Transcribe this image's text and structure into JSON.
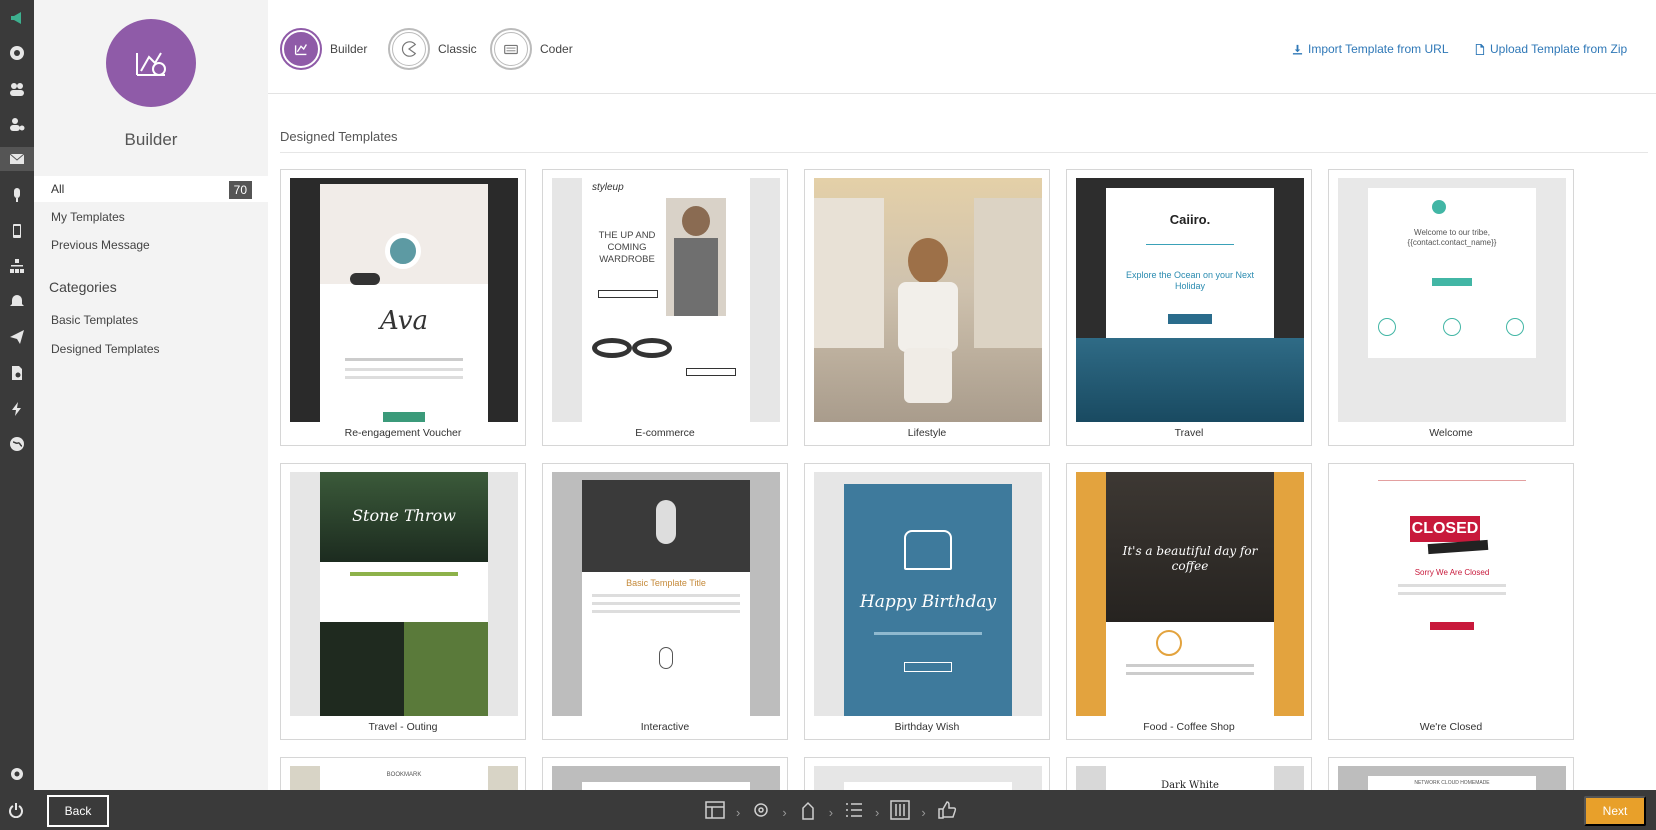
{
  "sidebar": {
    "title": "Builder",
    "nav": {
      "all_label": "All",
      "all_count": "70",
      "my_templates": "My Templates",
      "previous_message": "Previous Message"
    },
    "categories_heading": "Categories",
    "categories": [
      "Basic Templates",
      "Designed Templates"
    ]
  },
  "modes": [
    {
      "label": "Builder",
      "active": true
    },
    {
      "label": "Classic",
      "active": false
    },
    {
      "label": "Coder",
      "active": false
    }
  ],
  "actions": {
    "import_url": "Import Template from URL",
    "upload_zip": "Upload Template from Zip"
  },
  "section_title": "Designed Templates",
  "templates": [
    {
      "name": "Re-engagement Voucher",
      "thumb_text": "Ava"
    },
    {
      "name": "E-commerce",
      "thumb_text": "THE UP AND COMING WARDROBE",
      "brand": "styleup"
    },
    {
      "name": "Lifestyle",
      "thumb_text": ""
    },
    {
      "name": "Travel",
      "thumb_text": "Explore the Ocean on your Next Holiday",
      "brand": "Caiiro."
    },
    {
      "name": "Welcome",
      "thumb_text": "Welcome to our tribe, {{contact.contact_name}}"
    },
    {
      "name": "Travel - Outing",
      "thumb_text": "Stone Throw"
    },
    {
      "name": "Interactive",
      "thumb_text": "Basic Template Title"
    },
    {
      "name": "Birthday Wish",
      "thumb_text": "Happy Birthday"
    },
    {
      "name": "Food - Coffee Shop",
      "thumb_text": "It's a beautiful day for coffee"
    },
    {
      "name": "We're Closed",
      "thumb_text": "Sorry We Are Closed",
      "badge": "CLOSED"
    }
  ],
  "partial_row": [
    "BOOKMARK",
    "",
    "",
    "Dark White",
    "NETWORK CLOUD HOMEMADE"
  ],
  "bottom": {
    "back_label": "Back",
    "next_label": "Next"
  },
  "colors": {
    "accent": "#8f5ba8",
    "link": "#2f78b7",
    "next": "#e8a02a",
    "rail": "#3a3a3a"
  }
}
